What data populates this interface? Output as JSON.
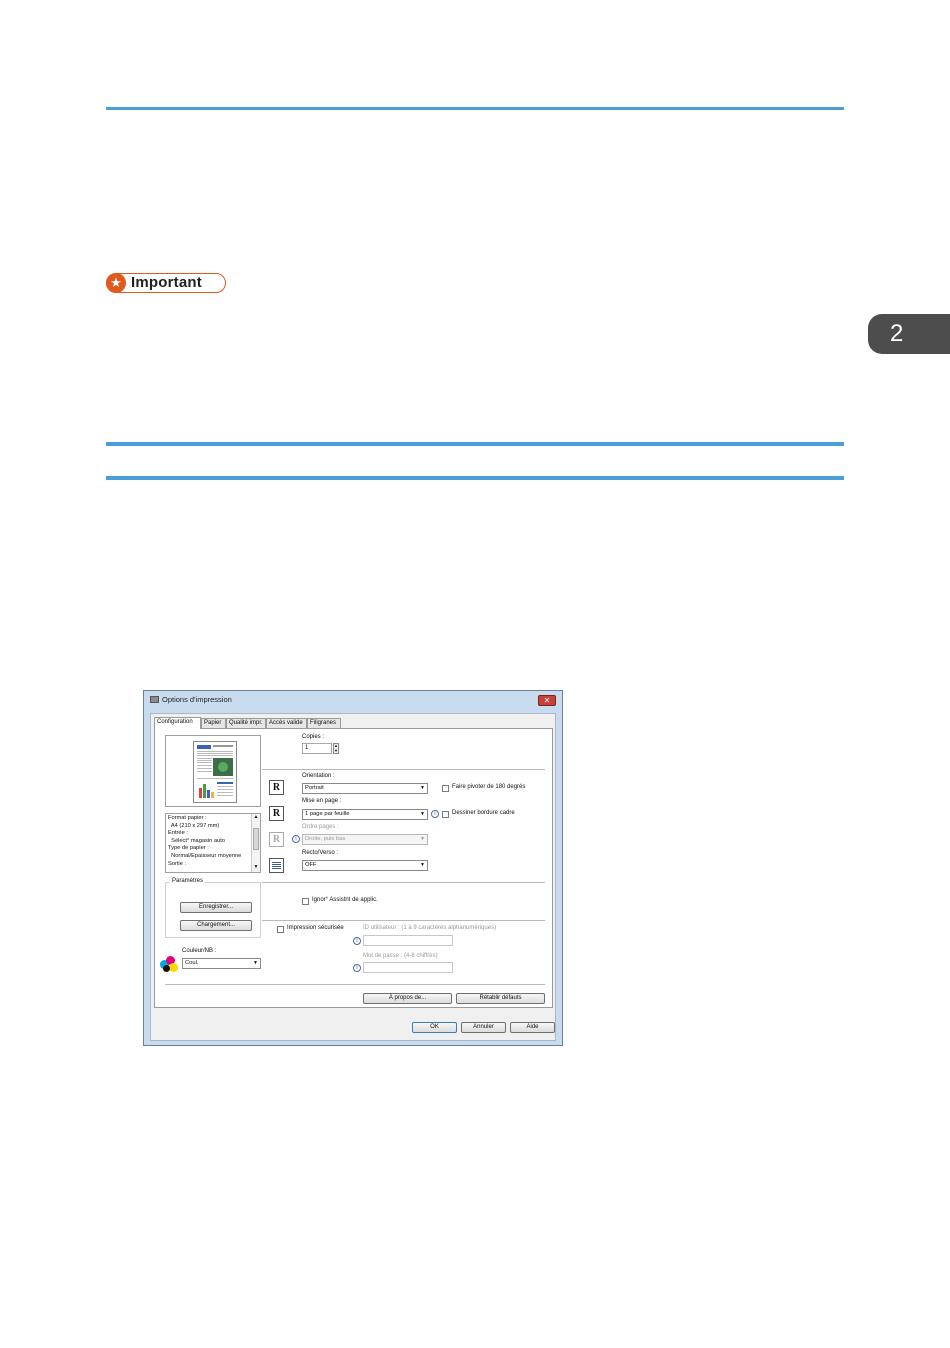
{
  "page": {
    "important_label": "Important",
    "chapter_number": "2",
    "accent_color": "#4a9fd8",
    "important_color": "#e05a1f"
  },
  "dialog": {
    "title": "Options d'impression",
    "close_glyph": "✕",
    "tabs": [
      "Configuration",
      "Papier",
      "Qualité impr.",
      "Accès valide",
      "Filigranes"
    ],
    "active_tab": "Configuration",
    "info_list": [
      "Format papier :",
      "  A4 (210 x 297 mm)",
      "Entrée :",
      "  Sélect° magasin auto",
      "Type de papier :",
      "  Normal/Épaisseur moyenne",
      "Sortie :"
    ],
    "settings_group": {
      "legend": "Paramètres",
      "save_button": "Enregistrer...",
      "load_button": "Chargement..."
    },
    "color_label": "Couleur/NB :",
    "color_value": "Coul.",
    "copies_label": "Copies :",
    "copies_value": "1",
    "orientation_label": "Orientation :",
    "orientation_value": "Portrait",
    "rotate_label": "Faire pivoter de 180 degrés",
    "layout_label": "Mise en page :",
    "layout_value": "1 page par feuille",
    "draw_border_label": "Dessiner bordure cadre",
    "page_order_label": "Ordre pages :",
    "page_order_value": "Droite, puis bas",
    "duplex_label": "Recto/Verso :",
    "duplex_value": "OFF",
    "ignore_app_label": "Ignor° Assistnt de applic.",
    "secure_print_label": "Impression sécurisée",
    "user_id_label": "ID utilisateur : (1 à 9 caractères alphanumériques)",
    "password_label": "Mot de passe : (4-8 chiffres)",
    "about_button": "À propos de...",
    "restore_button": "Rétablir défauts",
    "ok_button": "OK",
    "cancel_button": "Annuler",
    "help_button": "Aide",
    "r_glyph": "R"
  }
}
